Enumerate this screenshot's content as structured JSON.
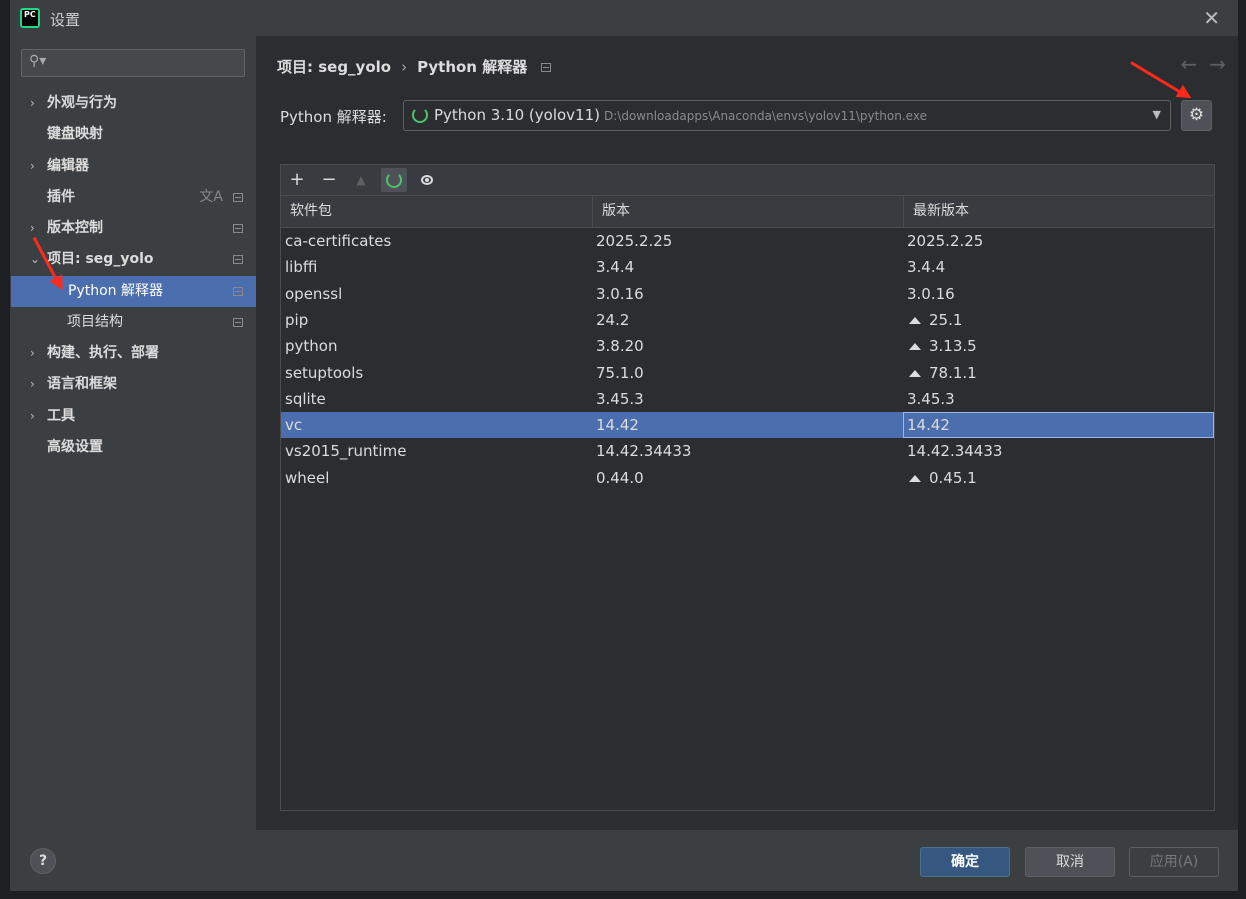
{
  "window": {
    "title": "设置",
    "app_icon_text": "PC"
  },
  "sidebar": {
    "search_placeholder": "",
    "items": [
      {
        "label": "外观与行为",
        "expandable": true,
        "expanded": false
      },
      {
        "label": "键盘映射",
        "expandable": false
      },
      {
        "label": "编辑器",
        "expandable": true,
        "expanded": false
      },
      {
        "label": "插件",
        "expandable": false
      },
      {
        "label": "版本控制",
        "expandable": true,
        "expanded": false
      },
      {
        "label": "项目: seg_yolo",
        "expandable": true,
        "expanded": true
      },
      {
        "label": "Python 解释器",
        "sub": true,
        "selected": true
      },
      {
        "label": "项目结构",
        "sub": true
      },
      {
        "label": "构建、执行、部署",
        "expandable": true,
        "expanded": false
      },
      {
        "label": "语言和框架",
        "expandable": true,
        "expanded": false
      },
      {
        "label": "工具",
        "expandable": true,
        "expanded": false
      },
      {
        "label": "高级设置",
        "expandable": false
      }
    ]
  },
  "header": {
    "breadcrumb_project": "项目: seg_yolo",
    "breadcrumb_separator": "›",
    "breadcrumb_page": "Python 解释器"
  },
  "interpreter": {
    "label": "Python 解释器:",
    "name": "Python 3.10 (yolov11)",
    "path": "D:\\downloadapps\\Anaconda\\envs\\yolov11\\python.exe"
  },
  "packages": {
    "columns": [
      "软件包",
      "版本",
      "最新版本"
    ],
    "rows": [
      {
        "name": "ca-certificates",
        "version": "2025.2.25",
        "latest": "2025.2.25",
        "upgrade": false
      },
      {
        "name": "libffi",
        "version": "3.4.4",
        "latest": "3.4.4",
        "upgrade": false
      },
      {
        "name": "openssl",
        "version": "3.0.16",
        "latest": "3.0.16",
        "upgrade": false
      },
      {
        "name": "pip",
        "version": "24.2",
        "latest": "25.1",
        "upgrade": true
      },
      {
        "name": "python",
        "version": "3.8.20",
        "latest": "3.13.5",
        "upgrade": true
      },
      {
        "name": "setuptools",
        "version": "75.1.0",
        "latest": "78.1.1",
        "upgrade": true
      },
      {
        "name": "sqlite",
        "version": "3.45.3",
        "latest": "3.45.3",
        "upgrade": false
      },
      {
        "name": "vc",
        "version": "14.42",
        "latest": "14.42",
        "upgrade": false,
        "selected": true
      },
      {
        "name": "vs2015_runtime",
        "version": "14.42.34433",
        "latest": "14.42.34433",
        "upgrade": false
      },
      {
        "name": "wheel",
        "version": "0.44.0",
        "latest": "0.45.1",
        "upgrade": true
      }
    ]
  },
  "footer": {
    "help": "?",
    "ok": "确定",
    "cancel": "取消",
    "apply": "应用(A)"
  },
  "colors": {
    "accent_selection": "#4b6eaf",
    "annotation_arrow": "#ff2a1a",
    "loading_ring": "#4fc26a"
  },
  "icons": {
    "search": "search-icon",
    "settings": "gear-icon",
    "add": "plus-icon",
    "remove": "minus-icon",
    "upgrade": "triangle-up-icon",
    "refresh": "loading-ring-icon",
    "show_early_releases": "eye-icon",
    "back": "arrow-left-icon",
    "forward": "arrow-right-icon"
  }
}
